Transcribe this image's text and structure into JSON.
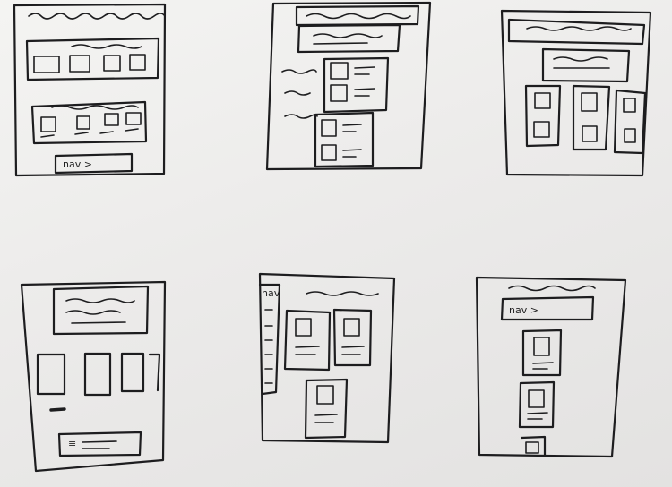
{
  "photo": {
    "subject": "hand-drawn wireframe sketches on paper",
    "frames": [
      {
        "id": "sketch-1",
        "label": "nav >"
      },
      {
        "id": "sketch-2",
        "label": ""
      },
      {
        "id": "sketch-3",
        "label": ""
      },
      {
        "id": "sketch-4",
        "label": ""
      },
      {
        "id": "sketch-5",
        "label": "nav"
      },
      {
        "id": "sketch-6",
        "label": "nav >"
      }
    ]
  },
  "colors": {
    "ink": "#1d1d1f",
    "paper": "#efefed"
  }
}
